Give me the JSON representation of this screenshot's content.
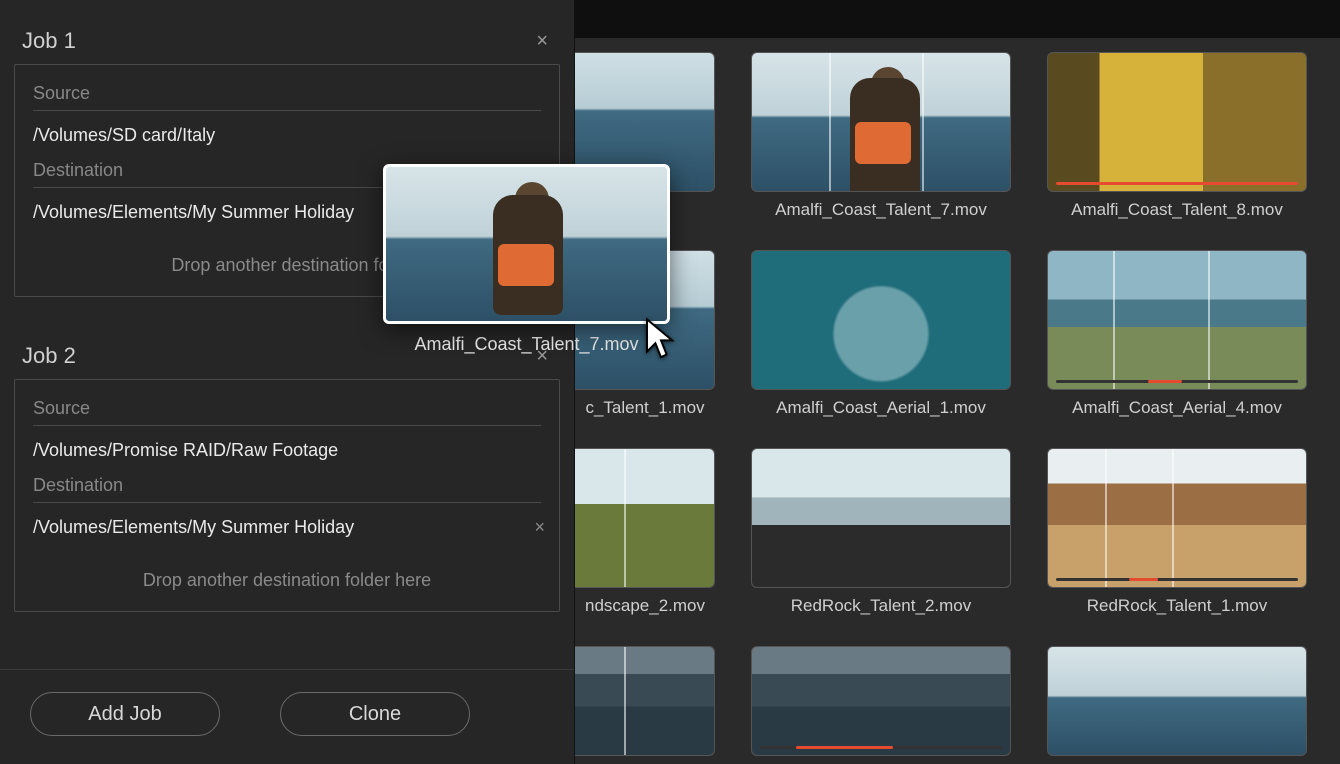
{
  "panel": {
    "jobs": [
      {
        "title": "Job 1",
        "source_label": "Source",
        "source_path": "/Volumes/SD card/Italy",
        "dest_label": "Destination",
        "dest_path": "/Volumes/Elements/My Summer Holiday",
        "drop_hint": "Drop another destination fold",
        "show_dest_remove": false
      },
      {
        "title": "Job 2",
        "source_label": "Source",
        "source_path": "/Volumes/Promise RAID/Raw Footage",
        "dest_label": "Destination",
        "dest_path": "/Volumes/Elements/My Summer Holiday",
        "drop_hint": "Drop another destination folder here",
        "show_dest_remove": true
      }
    ],
    "add_job_label": "Add Job",
    "clone_label": "Clone"
  },
  "drag": {
    "caption": "Amalfi_Coast_Talent_7.mov"
  },
  "grid": {
    "rows": [
      [
        {
          "caption": "",
          "partial": true,
          "style": "sky-sea-1"
        },
        {
          "caption": "Amalfi_Coast_Talent_7.mov",
          "style": "sky-sea-2 talent7",
          "vlines": [
            30,
            66
          ]
        },
        {
          "caption": "Amalfi_Coast_Talent_8.mov",
          "style": "interior",
          "scrub_full": true
        }
      ],
      [
        {
          "caption": "c_Talent_1.mov",
          "partial": true,
          "style": "sky-sea-1"
        },
        {
          "caption": "Amalfi_Coast_Aerial_1.mov",
          "style": "aerial"
        },
        {
          "caption": "Amalfi_Coast_Aerial_4.mov",
          "style": "coast",
          "vlines": [
            25,
            62
          ],
          "scrub_seg": [
            38,
            52
          ]
        }
      ],
      [
        {
          "caption": "ndscape_2.mov",
          "partial": true,
          "style": "grass",
          "vlines": [
            35
          ]
        },
        {
          "caption": "RedRock_Talent_2.mov",
          "style": "car"
        },
        {
          "caption": "RedRock_Talent_1.mov",
          "style": "desert",
          "vlines": [
            22,
            48
          ],
          "scrub_seg": [
            30,
            42
          ]
        }
      ],
      [
        {
          "caption": "",
          "partial": true,
          "style": "porch",
          "vlines": [
            35
          ]
        },
        {
          "caption": "",
          "style": "porch",
          "scrub_seg": [
            15,
            55
          ]
        },
        {
          "caption": "",
          "style": "sky-sea-2"
        }
      ]
    ]
  }
}
